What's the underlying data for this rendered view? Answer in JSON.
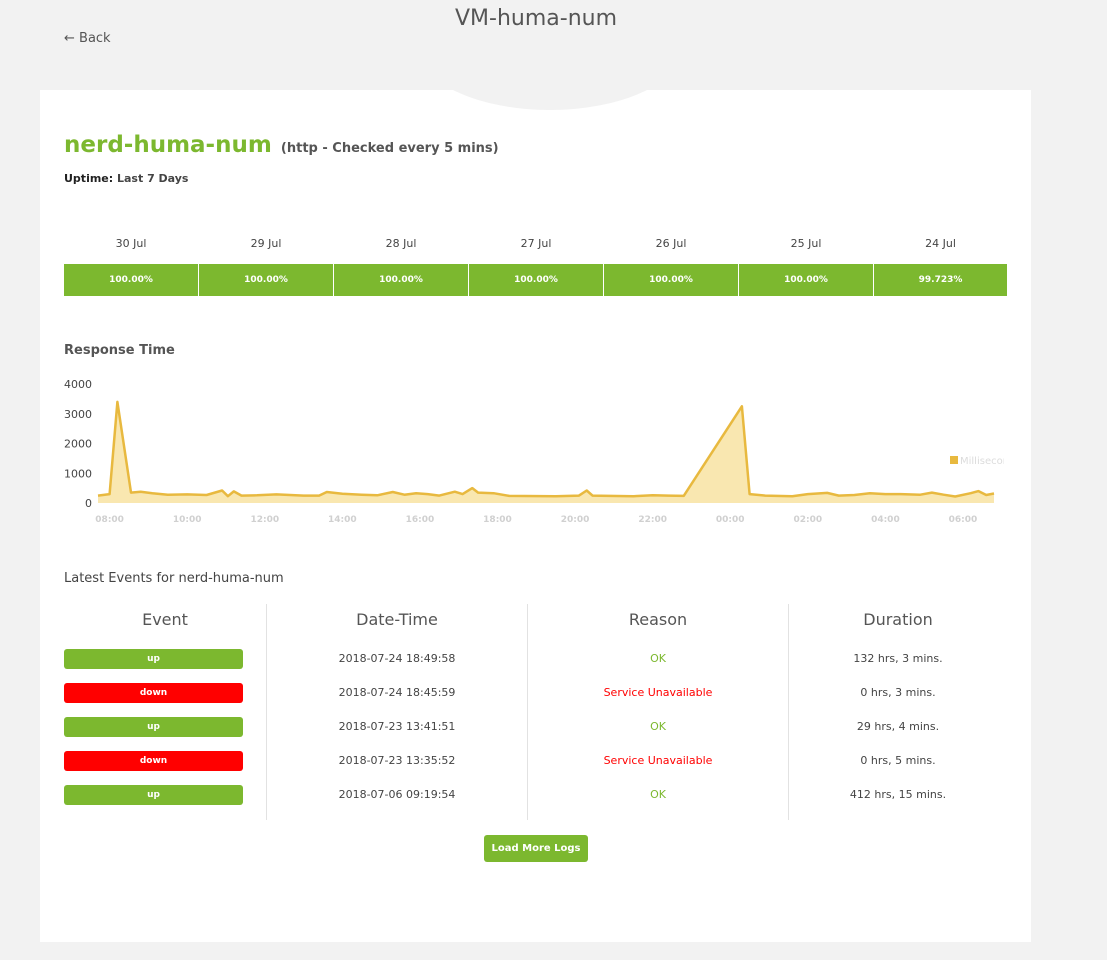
{
  "header": {
    "back_label": "← Back",
    "page_title": "VM-huma-num"
  },
  "monitor": {
    "name": "nerd-huma-num",
    "meta": "(http - Checked every 5 mins)",
    "uptime_label": "Uptime:",
    "uptime_range": "Last 7 Days"
  },
  "days": [
    {
      "date": "30 Jul",
      "uptime": "100.00%"
    },
    {
      "date": "29 Jul",
      "uptime": "100.00%"
    },
    {
      "date": "28 Jul",
      "uptime": "100.00%"
    },
    {
      "date": "27 Jul",
      "uptime": "100.00%"
    },
    {
      "date": "26 Jul",
      "uptime": "100.00%"
    },
    {
      "date": "25 Jul",
      "uptime": "100.00%"
    },
    {
      "date": "24 Jul",
      "uptime": "99.723%"
    }
  ],
  "response_time": {
    "title": "Response Time"
  },
  "colors": {
    "accent_green": "#7cb82f",
    "down_red": "#ff0000",
    "chart_line": "#e8b93f",
    "chart_fill": "#f9e7b0"
  },
  "chart_data": {
    "type": "area",
    "title": "",
    "xlabel": "",
    "ylabel": "",
    "ylim": [
      0,
      4000
    ],
    "yticks": [
      0,
      1000,
      2000,
      3000,
      4000
    ],
    "xlim": [
      7.7,
      30.8
    ],
    "xticks": [
      "08:00",
      "10:00",
      "12:00",
      "14:00",
      "16:00",
      "18:00",
      "20:00",
      "22:00",
      "00:00",
      "02:00",
      "04:00",
      "06:00"
    ],
    "legend_position": "top-right",
    "grid": false,
    "series": [
      {
        "name": "Milliseconds",
        "points": [
          [
            7.7,
            250
          ],
          [
            8.0,
            300
          ],
          [
            8.2,
            3400
          ],
          [
            8.55,
            350
          ],
          [
            8.8,
            380
          ],
          [
            9.1,
            330
          ],
          [
            9.5,
            280
          ],
          [
            10.0,
            290
          ],
          [
            10.5,
            270
          ],
          [
            10.9,
            420
          ],
          [
            11.05,
            230
          ],
          [
            11.2,
            390
          ],
          [
            11.4,
            250
          ],
          [
            11.8,
            260
          ],
          [
            12.3,
            290
          ],
          [
            13.0,
            250
          ],
          [
            13.4,
            250
          ],
          [
            13.6,
            370
          ],
          [
            14.0,
            310
          ],
          [
            14.5,
            280
          ],
          [
            14.9,
            260
          ],
          [
            15.3,
            370
          ],
          [
            15.6,
            280
          ],
          [
            15.9,
            330
          ],
          [
            16.2,
            300
          ],
          [
            16.5,
            250
          ],
          [
            16.9,
            380
          ],
          [
            17.1,
            300
          ],
          [
            17.35,
            500
          ],
          [
            17.5,
            350
          ],
          [
            17.9,
            330
          ],
          [
            18.3,
            240
          ],
          [
            19.5,
            230
          ],
          [
            20.1,
            250
          ],
          [
            20.3,
            420
          ],
          [
            20.45,
            250
          ],
          [
            21.5,
            230
          ],
          [
            22.0,
            260
          ],
          [
            22.4,
            250
          ],
          [
            22.8,
            240
          ],
          [
            24.3,
            3250
          ],
          [
            24.5,
            300
          ],
          [
            24.9,
            250
          ],
          [
            25.6,
            230
          ],
          [
            26.0,
            300
          ],
          [
            26.5,
            340
          ],
          [
            26.8,
            250
          ],
          [
            27.2,
            270
          ],
          [
            27.6,
            330
          ],
          [
            28.0,
            300
          ],
          [
            28.4,
            300
          ],
          [
            28.9,
            280
          ],
          [
            29.2,
            350
          ],
          [
            29.5,
            280
          ],
          [
            29.8,
            220
          ],
          [
            30.2,
            330
          ],
          [
            30.4,
            400
          ],
          [
            30.6,
            270
          ],
          [
            30.8,
            320
          ]
        ]
      }
    ]
  },
  "events": {
    "title": "Latest Events for nerd-huma-num",
    "headers": {
      "event": "Event",
      "datetime": "Date-Time",
      "reason": "Reason",
      "duration": "Duration"
    },
    "rows": [
      {
        "status": "up",
        "datetime": "2018-07-24 18:49:58",
        "reason": "OK",
        "duration": "132 hrs, 3 mins."
      },
      {
        "status": "down",
        "datetime": "2018-07-24 18:45:59",
        "reason": "Service Unavailable",
        "duration": "0 hrs, 3 mins."
      },
      {
        "status": "up",
        "datetime": "2018-07-23 13:41:51",
        "reason": "OK",
        "duration": "29 hrs, 4 mins."
      },
      {
        "status": "down",
        "datetime": "2018-07-23 13:35:52",
        "reason": "Service Unavailable",
        "duration": "0 hrs, 5 mins."
      },
      {
        "status": "up",
        "datetime": "2018-07-06 09:19:54",
        "reason": "OK",
        "duration": "412 hrs, 15 mins."
      }
    ],
    "load_more_label": "Load More Logs"
  }
}
